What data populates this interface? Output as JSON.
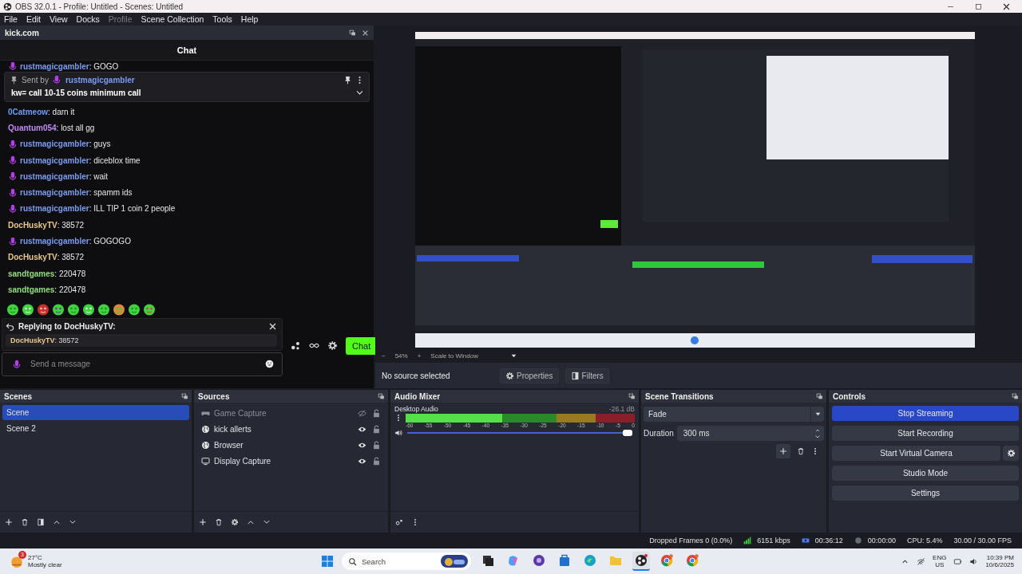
{
  "window": {
    "title": "OBS 32.0.1 - Profile: Untitled - Scenes: Untitled"
  },
  "menu": [
    {
      "label": "File",
      "disabled": false
    },
    {
      "label": "Edit",
      "disabled": false
    },
    {
      "label": "View",
      "disabled": false
    },
    {
      "label": "Docks",
      "disabled": false
    },
    {
      "label": "Profile",
      "disabled": true
    },
    {
      "label": "Scene Collection",
      "disabled": false
    },
    {
      "label": "Tools",
      "disabled": false
    },
    {
      "label": "Help",
      "disabled": false
    }
  ],
  "chat_dock": {
    "title": "kick.com",
    "header": "Chat",
    "pinned": {
      "prefix": "Sent by",
      "user": "rustmagicgambler",
      "color": "#7b9cf0",
      "text": "kw= call 10-15 coins minimum call"
    },
    "messages": [
      {
        "user": "rustmagicgambler",
        "badge": true,
        "color": "#7b9cf0",
        "text": ": GOGO"
      },
      {
        "user": "0Catmeow",
        "badge": false,
        "color": "#6f9cf2",
        "text": ": darn it"
      },
      {
        "user": "Quantum054",
        "badge": false,
        "color": "#c08cf5",
        "text": ": lost all gg"
      },
      {
        "user": "rustmagicgambler",
        "badge": true,
        "color": "#7b9cf0",
        "text": ": guys"
      },
      {
        "user": "rustmagicgambler",
        "badge": true,
        "color": "#7b9cf0",
        "text": ": diceblox time"
      },
      {
        "user": "rustmagicgambler",
        "badge": true,
        "color": "#7b9cf0",
        "text": ": wait"
      },
      {
        "user": "rustmagicgambler",
        "badge": true,
        "color": "#7b9cf0",
        "text": ": spamm ids"
      },
      {
        "user": "rustmagicgambler",
        "badge": true,
        "color": "#7b9cf0",
        "text": ": ILL TIP 1 coin 2 people"
      },
      {
        "user": "DocHuskyTV",
        "badge": false,
        "color": "#e6c88c",
        "text": ": 38572"
      },
      {
        "user": "rustmagicgambler",
        "badge": true,
        "color": "#7b9cf0",
        "text": ": GOGOGO"
      },
      {
        "user": "DocHuskyTV",
        "badge": false,
        "color": "#e6c88c",
        "text": ": 38572"
      },
      {
        "user": "sandtgames",
        "badge": false,
        "color": "#8fe07a",
        "text": ": 220478"
      },
      {
        "user": "sandtgames",
        "badge": false,
        "color": "#8fe07a",
        "text": ": 220478"
      }
    ],
    "emotes": [
      {
        "kind": "blob"
      },
      {
        "kind": "angel"
      },
      {
        "kind": "brick"
      },
      {
        "kind": "shades"
      },
      {
        "kind": "blob"
      },
      {
        "kind": "headset"
      },
      {
        "kind": "blob"
      },
      {
        "kind": "burger"
      },
      {
        "kind": "blob"
      },
      {
        "kind": "heart"
      }
    ],
    "reply": {
      "title": "Replying to DocHuskyTV:",
      "user": "DocHuskyTV",
      "color": "#e6c88c",
      "text": ": 38572"
    },
    "input": {
      "placeholder": "Send a message"
    },
    "send_button": "Chat"
  },
  "zoom_bar": {
    "minus": "−",
    "zoom": "54%",
    "plus": "+",
    "scale": "Scale to Window"
  },
  "context_bar": {
    "status": "No source selected",
    "buttons": [
      {
        "kind": "properties",
        "label": "Properties"
      },
      {
        "kind": "filters",
        "label": "Filters"
      }
    ]
  },
  "scenes": {
    "title": "Scenes",
    "items": [
      {
        "label": "Scene",
        "selected": true
      },
      {
        "label": "Scene 2",
        "selected": false
      }
    ]
  },
  "sources": {
    "title": "Sources",
    "items": [
      {
        "kind": "game",
        "label": "Game Capture",
        "visible": false
      },
      {
        "kind": "browser",
        "label": "kick allerts",
        "visible": true
      },
      {
        "kind": "browser",
        "label": "Browser",
        "visible": true
      },
      {
        "kind": "display",
        "label": "Display Capture",
        "visible": true
      }
    ]
  },
  "audio": {
    "title": "Audio Mixer",
    "channels": [
      {
        "name": "Desktop Audio",
        "reading": "-26.1 dB",
        "meter": {
          "level": 0.42
        },
        "volume": {
          "level": 0.97
        }
      }
    ],
    "scale": [
      "-60",
      "-55",
      "-50",
      "-45",
      "-40",
      "-35",
      "-30",
      "-25",
      "-20",
      "-15",
      "-10",
      "-5",
      "0"
    ]
  },
  "transitions": {
    "title": "Scene Transitions",
    "transition": "Fade",
    "duration_label": "Duration",
    "duration": "300 ms"
  },
  "controls": {
    "title": "Controls",
    "buttons": [
      {
        "label": "Stop Streaming",
        "active": true
      },
      {
        "label": "Start Recording",
        "active": false
      },
      {
        "label": "Start Virtual Camera",
        "active": false
      },
      {
        "label": "Studio Mode",
        "active": false
      },
      {
        "label": "Settings",
        "active": false
      }
    ]
  },
  "status_bar": [
    {
      "kind": "text",
      "text": "Dropped Frames 0 (0.0%)"
    },
    {
      "kind": "network",
      "text": "6151 kbps"
    },
    {
      "kind": "stream",
      "text": "00:36:12"
    },
    {
      "kind": "record",
      "text": "00:00:00"
    },
    {
      "kind": "text",
      "text": "CPU: 5.4%"
    },
    {
      "kind": "text",
      "text": "30.00 / 30.00 FPS"
    }
  ],
  "taskbar": {
    "weather": {
      "badge": "3",
      "temp": "27°C",
      "condition": "Mostly clear"
    },
    "search": {
      "placeholder": "Search"
    },
    "apps": [
      {
        "kind": "taskview",
        "active": false
      },
      {
        "kind": "copilot",
        "active": false
      },
      {
        "kind": "purple",
        "active": false
      },
      {
        "kind": "store",
        "active": false
      },
      {
        "kind": "edge",
        "active": false
      },
      {
        "kind": "folder",
        "active": false
      },
      {
        "kind": "obs",
        "active": true
      },
      {
        "kind": "chrome",
        "active": false
      },
      {
        "kind": "chrome",
        "active": false
      }
    ],
    "language": "ENG",
    "region": "US",
    "time": "10:39 PM",
    "date": "10/6/2025"
  }
}
